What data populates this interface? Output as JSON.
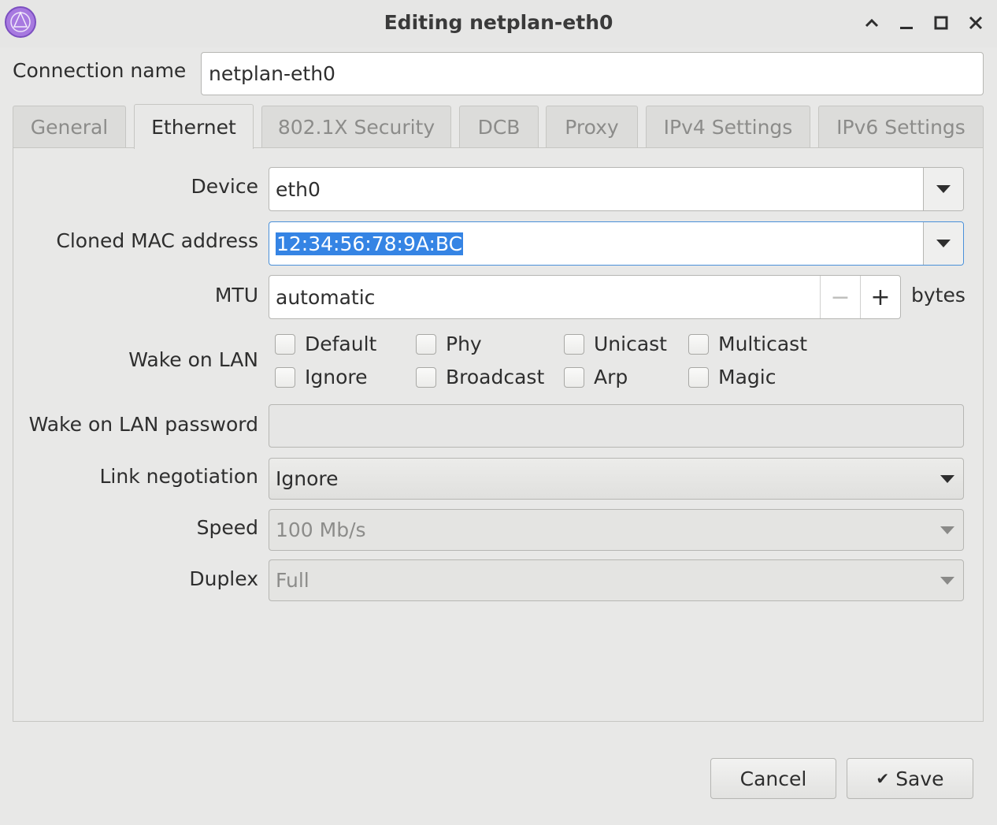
{
  "window": {
    "title": "Editing netplan-eth0"
  },
  "connection": {
    "label": "Connection name",
    "value": "netplan-eth0"
  },
  "tabs": [
    {
      "label": "General"
    },
    {
      "label": "Ethernet"
    },
    {
      "label": "802.1X Security"
    },
    {
      "label": "DCB"
    },
    {
      "label": "Proxy"
    },
    {
      "label": "IPv4 Settings"
    },
    {
      "label": "IPv6 Settings"
    }
  ],
  "active_tab": "Ethernet",
  "ethernet": {
    "device": {
      "label": "Device",
      "value": "eth0"
    },
    "cloned_mac": {
      "label": "Cloned MAC address",
      "value": "12:34:56:78:9A:BC"
    },
    "mtu": {
      "label": "MTU",
      "value": "automatic",
      "unit": "bytes",
      "minus": "−",
      "plus": "+"
    },
    "wake_on_lan": {
      "label": "Wake on LAN",
      "options": [
        {
          "label": "Default",
          "checked": false
        },
        {
          "label": "Phy",
          "checked": false
        },
        {
          "label": "Unicast",
          "checked": false
        },
        {
          "label": "Multicast",
          "checked": false
        },
        {
          "label": "Ignore",
          "checked": false
        },
        {
          "label": "Broadcast",
          "checked": false
        },
        {
          "label": "Arp",
          "checked": false
        },
        {
          "label": "Magic",
          "checked": false
        }
      ]
    },
    "wol_password": {
      "label": "Wake on LAN password",
      "value": ""
    },
    "link_negotiation": {
      "label": "Link negotiation",
      "value": "Ignore"
    },
    "speed": {
      "label": "Speed",
      "value": "100 Mb/s"
    },
    "duplex": {
      "label": "Duplex",
      "value": "Full"
    }
  },
  "buttons": {
    "cancel": "Cancel",
    "save": "Save",
    "save_icon": "✔"
  },
  "colors": {
    "selection": "#3584e4",
    "app_icon": "#9b6dd6"
  }
}
